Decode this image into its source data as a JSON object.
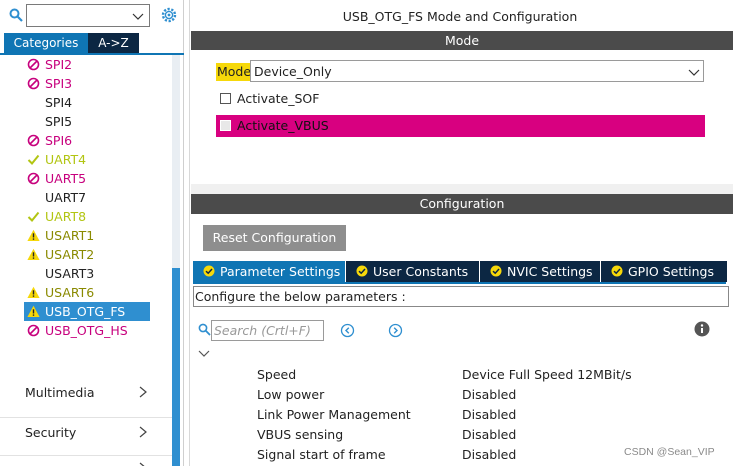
{
  "left_panel": {
    "tabs": {
      "categories": "Categories",
      "az": "A->Z"
    },
    "peripherals": [
      {
        "name": "SPI2",
        "status": "disabled"
      },
      {
        "name": "SPI3",
        "status": "disabled"
      },
      {
        "name": "SPI4",
        "status": "none"
      },
      {
        "name": "SPI5",
        "status": "none"
      },
      {
        "name": "SPI6",
        "status": "disabled"
      },
      {
        "name": "UART4",
        "status": "ok"
      },
      {
        "name": "UART5",
        "status": "disabled"
      },
      {
        "name": "UART7",
        "status": "none"
      },
      {
        "name": "UART8",
        "status": "ok"
      },
      {
        "name": "USART1",
        "status": "warn"
      },
      {
        "name": "USART2",
        "status": "warn"
      },
      {
        "name": "USART3",
        "status": "none"
      },
      {
        "name": "USART6",
        "status": "warn"
      },
      {
        "name": "USB_OTG_FS",
        "status": "warn",
        "selected": true
      },
      {
        "name": "USB_OTG_HS",
        "status": "disabled"
      }
    ],
    "categories": {
      "multimedia": "Multimedia",
      "security": "Security"
    }
  },
  "main": {
    "title": "USB_OTG_FS Mode and Configuration",
    "mode_section": "Mode",
    "mode_label": "Mode",
    "mode_value": "Device_Only",
    "activate_sof": "Activate_SOF",
    "activate_vbus": "Activate_VBUS",
    "config_section": "Configuration",
    "reset_button": "Reset Configuration",
    "tabs": {
      "params": "Parameter Settings",
      "user_constants": "User Constants",
      "nvic": "NVIC Settings",
      "gpio": "GPIO Settings"
    },
    "config_note": "Configure the below parameters :",
    "search_placeholder": "Search (Crtl+F)",
    "parameters": [
      {
        "name": "Speed",
        "value": "Device Full Speed 12MBit/s"
      },
      {
        "name": "Low power",
        "value": "Disabled"
      },
      {
        "name": "Link Power Management",
        "value": "Disabled"
      },
      {
        "name": "VBUS sensing",
        "value": "Disabled"
      },
      {
        "name": "Signal start of frame",
        "value": "Disabled"
      }
    ]
  },
  "watermark": "CSDN @Sean_VIP",
  "colors": {
    "accent": "#0f75b4",
    "dark_tab": "#0c2743",
    "disabled": "#c7007d",
    "ok": "#b2c512",
    "warn": "#f6d80a",
    "section_bar": "#4b4b4b"
  }
}
